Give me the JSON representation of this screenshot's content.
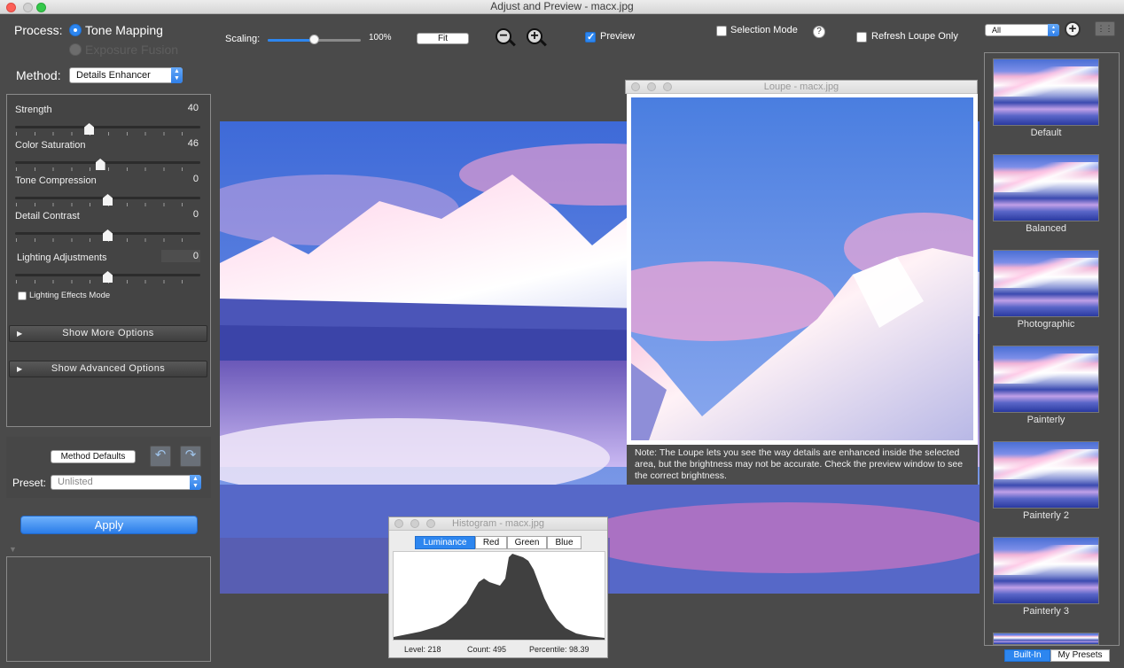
{
  "window": {
    "title": "Adjust and Preview - macx.jpg"
  },
  "process": {
    "label": "Process:",
    "options": [
      {
        "label": "Tone Mapping",
        "selected": true
      },
      {
        "label": "Exposure Fusion",
        "selected": false
      }
    ]
  },
  "method": {
    "label": "Method:",
    "value": "Details Enhancer"
  },
  "sliders": [
    {
      "label": "Strength",
      "value": "40"
    },
    {
      "label": "Color Saturation",
      "value": "46"
    },
    {
      "label": "Tone Compression",
      "value": "0"
    },
    {
      "label": "Detail Contrast",
      "value": "0"
    },
    {
      "label": "Lighting Adjustments",
      "value": "0"
    }
  ],
  "slider_levels": [
    0.4,
    0.46,
    0.5,
    0.5,
    0.5
  ],
  "lighting_effects_mode": {
    "label": "Lighting Effects Mode",
    "checked": false
  },
  "disclosures": {
    "more": "Show More Options",
    "advanced": "Show Advanced Options"
  },
  "defaults": {
    "button": "Method Defaults",
    "preset_label": "Preset:",
    "preset_value": "Unlisted"
  },
  "apply_label": "Apply",
  "toolbar": {
    "scaling_label": "Scaling:",
    "scaling_value": "100%",
    "scaling_level": 0.5,
    "fit_label": "Fit",
    "preview_label": "Preview",
    "preview_checked": true,
    "selection_mode_label": "Selection Mode",
    "selection_mode_checked": false,
    "help_label": "?",
    "refresh_loupe_label": "Refresh Loupe Only",
    "refresh_loupe_checked": false,
    "filter_value": "All"
  },
  "loupe": {
    "title": "Loupe - macx.jpg",
    "note": "Note: The Loupe lets you see the way details are enhanced inside the selected area, but the brightness may not be accurate. Check the preview window to see the correct brightness."
  },
  "histogram": {
    "title": "Histogram - macx.jpg",
    "tabs": [
      "Luminance",
      "Red",
      "Green",
      "Blue"
    ],
    "active_tab": "Luminance",
    "level": "Level: 218",
    "count": "Count: 495",
    "percentile": "Percentile: 98.39"
  },
  "presets": {
    "items": [
      "Default",
      "Balanced",
      "Photographic",
      "Painterly",
      "Painterly 2",
      "Painterly 3"
    ],
    "tabs": [
      "Built-In",
      "My Presets"
    ],
    "active_tab": "Built-In"
  },
  "colors": {
    "accent": "#2d86ef",
    "background": "#4a4a4a",
    "close": "#fc5f57",
    "minimize": "#fdbc2e",
    "zoom": "#34c84a"
  },
  "icons": [
    "close-icon",
    "minimize-icon",
    "zoom-icon",
    "zoom-out-icon",
    "zoom-in-icon",
    "add-preset-icon",
    "grid-view-icon",
    "undo-icon",
    "redo-icon",
    "help-icon"
  ]
}
